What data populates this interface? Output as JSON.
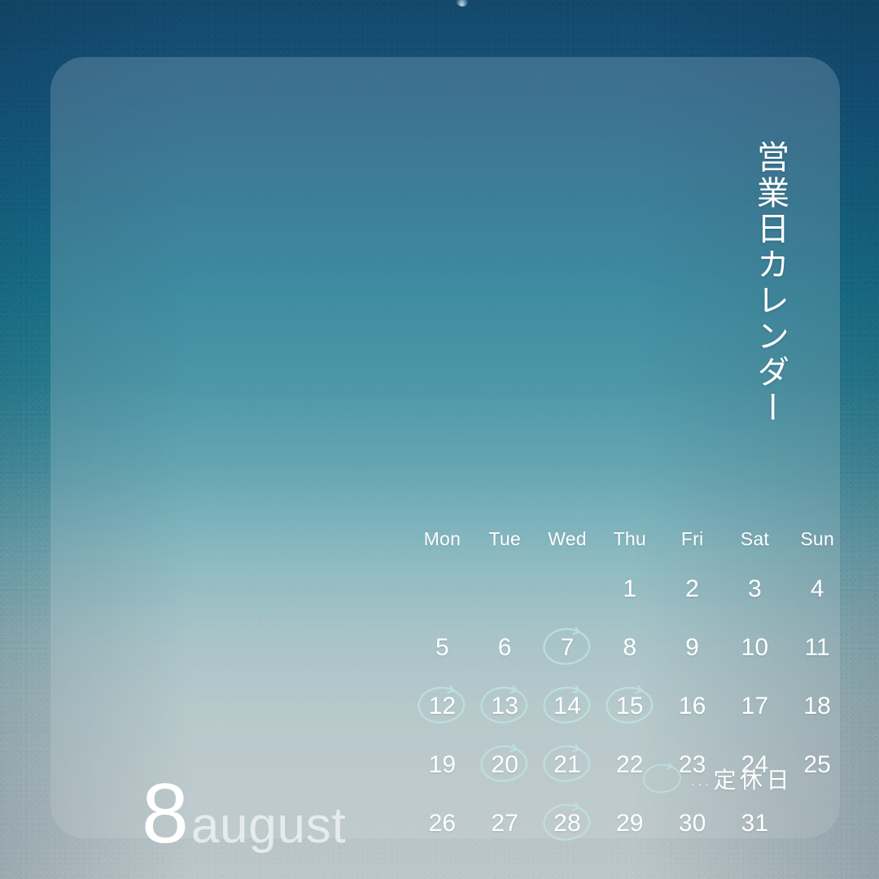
{
  "card": {
    "vertical_title": "営業日カレンダー",
    "month_number": "8",
    "month_name": "august"
  },
  "calendar": {
    "weekday_headers": [
      "Mon",
      "Tue",
      "Wed",
      "Thu",
      "Fri",
      "Sat",
      "Sun"
    ],
    "first_weekday_index": 3,
    "days_in_month": 31,
    "weeks": [
      [
        "",
        "",
        "",
        "1",
        "2",
        "3",
        "4"
      ],
      [
        "5",
        "6",
        "7",
        "8",
        "9",
        "10",
        "11"
      ],
      [
        "12",
        "13",
        "14",
        "15",
        "16",
        "17",
        "18"
      ],
      [
        "19",
        "20",
        "21",
        "22",
        "23",
        "24",
        "25"
      ],
      [
        "26",
        "27",
        "28",
        "29",
        "30",
        "31",
        ""
      ]
    ],
    "circled_days": [
      "7",
      "12",
      "13",
      "14",
      "15",
      "20",
      "21",
      "28"
    ]
  },
  "legend": {
    "marker": "circle",
    "dots": "…",
    "label": "定休日"
  },
  "colors": {
    "ring": "#bfe2e0",
    "text": "#ffffff",
    "month_name": "rgba(255,255,255,0.62)",
    "background_top": "#14486b",
    "background_mid": "#2c8498",
    "background_bottom": "#bcc7c9",
    "card_overlay": "rgba(255,255,255,0.15)"
  }
}
